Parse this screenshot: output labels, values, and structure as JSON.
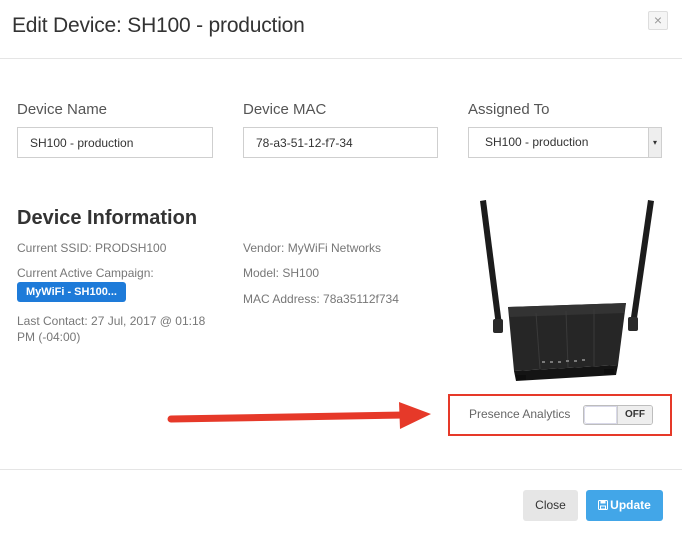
{
  "modal": {
    "title": "Edit Device: SH100 - production",
    "close_glyph": "×",
    "close_icon": "close-icon"
  },
  "form": {
    "device_name": {
      "label": "Device Name",
      "value": "SH100 - production"
    },
    "device_mac": {
      "label": "Device MAC",
      "value": "78-a3-51-12-f7-34"
    },
    "assigned_to": {
      "label": "Assigned To",
      "value": "SH100 - production",
      "arrow": "▾"
    }
  },
  "device_info": {
    "title": "Device Information",
    "current_ssid": "Current SSID: PRODSH100",
    "campaign_label": "Current Active Campaign:",
    "campaign_badge": "MyWiFi - SH100...",
    "last_contact_line1": "Last Contact: 27 Jul, 2017 @ 01:18",
    "last_contact_line2": "PM (-04:00)",
    "vendor": "Vendor: MyWiFi Networks",
    "model": "Model: SH100",
    "mac_address": "MAC Address: 78a35112f734"
  },
  "presence": {
    "label": "Presence Analytics",
    "toggle_state": "OFF"
  },
  "footer": {
    "close_label": "Close",
    "update_label": "Update"
  },
  "colors": {
    "badge": "#1e7bd9",
    "update_button": "#42a6e8",
    "highlight": "#e63929"
  }
}
